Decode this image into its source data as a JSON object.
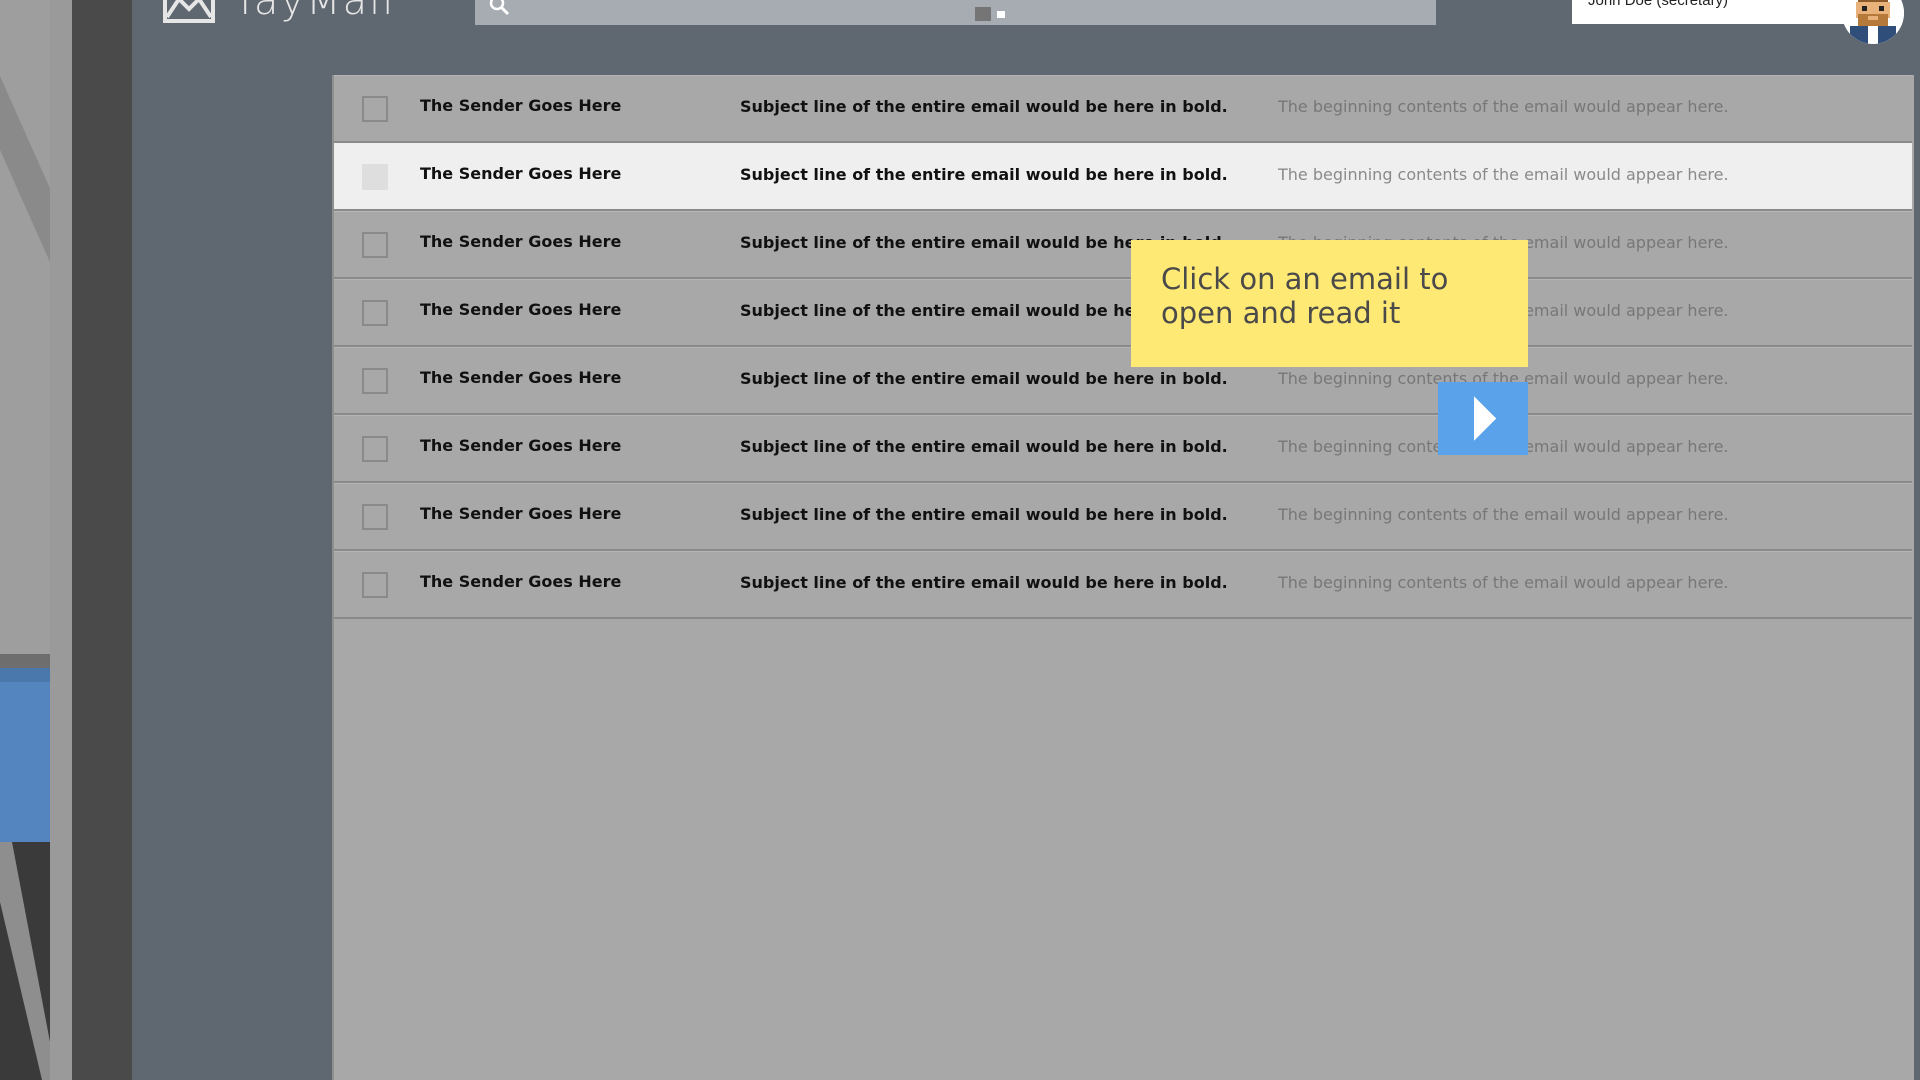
{
  "app": {
    "name": "YayMail",
    "user_label": "John Doe (secretary)"
  },
  "colors": {
    "background": "#5f6770",
    "panel": "#a8a8a8",
    "highlight_row": "#efefef",
    "tooltip": "#ffe975",
    "next_button": "#5aa2ea"
  },
  "icons": {
    "logo": "envelope-icon",
    "search": "search-icon",
    "next": "play-arrow-icon",
    "avatar": "pixel-avatar-icon"
  },
  "emails": [
    {
      "sender": "The Sender Goes Here",
      "subject": "Subject line of the entire email would be here in bold.",
      "preview": "The beginning contents of the email would appear here.",
      "highlighted": false
    },
    {
      "sender": "The Sender Goes Here",
      "subject": "Subject line of the entire email would be here in bold.",
      "preview": "The beginning contents of the email would appear here.",
      "highlighted": true
    },
    {
      "sender": "The Sender Goes Here",
      "subject": "Subject line of the entire email would be here in bold.",
      "preview": "The beginning contents of the email would appear here.",
      "highlighted": false
    },
    {
      "sender": "The Sender Goes Here",
      "subject": "Subject line of the entire email would be here in bold.",
      "preview": "The beginning contents of the email would appear here.",
      "highlighted": false
    },
    {
      "sender": "The Sender Goes Here",
      "subject": "Subject line of the entire email would be here in bold.",
      "preview": "The beginning contents of the email would appear here.",
      "highlighted": false
    },
    {
      "sender": "The Sender Goes Here",
      "subject": "Subject line of the entire email would be here in bold.",
      "preview": "The beginning contents of the email would appear here.",
      "highlighted": false
    },
    {
      "sender": "The Sender Goes Here",
      "subject": "Subject line of the entire email would be here in bold.",
      "preview": "The beginning contents of the email would appear here.",
      "highlighted": false
    },
    {
      "sender": "The Sender Goes Here",
      "subject": "Subject line of the entire email would be here in bold.",
      "preview": "The beginning contents of the email would appear here.",
      "highlighted": false
    }
  ],
  "tutorial": {
    "text": "Click on an email to open and read it"
  }
}
